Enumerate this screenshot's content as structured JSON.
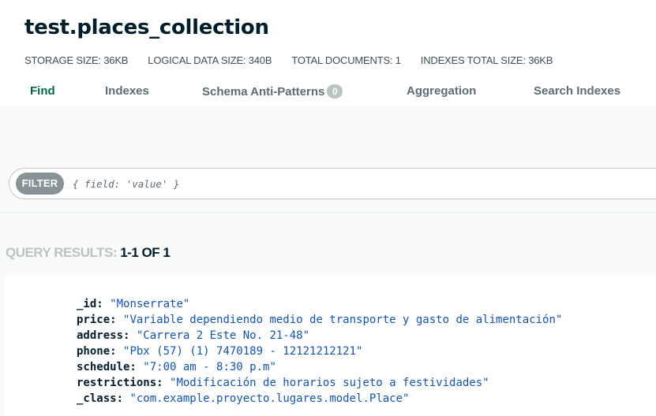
{
  "header": {
    "title": "test.places_collection",
    "stats": [
      {
        "label": "STORAGE SIZE:",
        "value": "36KB"
      },
      {
        "label": "LOGICAL DATA SIZE:",
        "value": "340B"
      },
      {
        "label": "TOTAL DOCUMENTS:",
        "value": "1"
      },
      {
        "label": "INDEXES TOTAL SIZE:",
        "value": "36KB"
      }
    ]
  },
  "tabs": {
    "find": "Find",
    "indexes": "Indexes",
    "schema": "Schema Anti-Patterns",
    "schema_badge": "0",
    "aggregation": "Aggregation",
    "search_indexes": "Search Indexes",
    "active": "find"
  },
  "filter": {
    "button_label": "FILTER",
    "placeholder": "{ field: 'value' }"
  },
  "results": {
    "label": "QUERY RESULTS:",
    "count": "1-1 OF 1"
  },
  "document": {
    "fields": [
      {
        "key": "_id:",
        "value": "\"Monserrate\""
      },
      {
        "key": "price:",
        "value": "\"Variable dependiendo medio de transporte y gasto de alimentación\""
      },
      {
        "key": "address:",
        "value": "\"Carrera 2 Este No. 21-48\""
      },
      {
        "key": "phone:",
        "value": "\"Pbx (57) (1) 7470189 - 12121212121\""
      },
      {
        "key": "schedule:",
        "value": "\"7:00 am - 8:30 p.m\""
      },
      {
        "key": "restrictions:",
        "value": "\"Modificación de horarios sujeto a festividades\""
      },
      {
        "key": "_class:",
        "value": "\"com.example.proyecto.lugares.model.Place\""
      }
    ]
  },
  "colors": {
    "accent_green": "#00684a",
    "value_blue": "#1254b7",
    "badge_gray": "#b8c4c2"
  }
}
